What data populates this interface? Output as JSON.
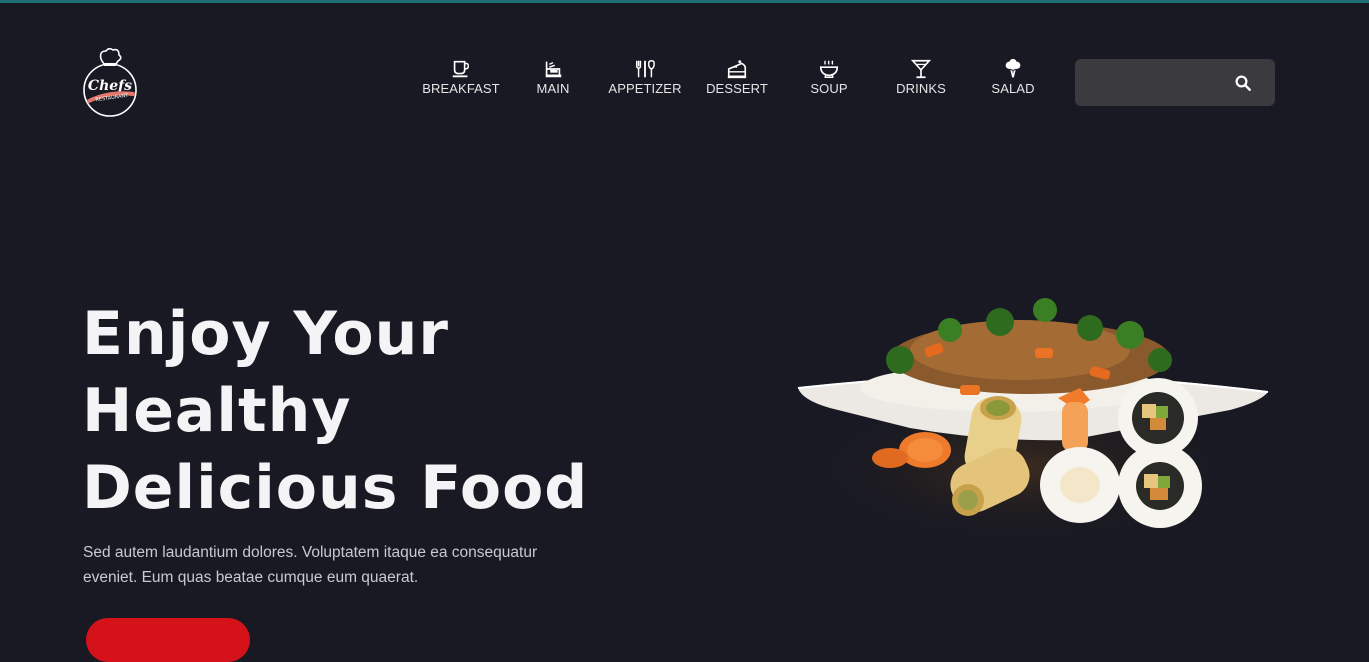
{
  "brand": {
    "logo_icon": "chef-hat-logo",
    "logo_text": "Chefs",
    "logo_subtext": "RESTAURANT"
  },
  "nav": {
    "items": [
      {
        "label": "BREAKFAST",
        "icon": "coffee-cup-icon"
      },
      {
        "label": "MAIN",
        "icon": "main-dish-icon"
      },
      {
        "label": "APPETIZER",
        "icon": "utensils-icon"
      },
      {
        "label": "DESSERT",
        "icon": "cake-icon"
      },
      {
        "label": "SOUP",
        "icon": "soup-bowl-icon"
      },
      {
        "label": "DRINKS",
        "icon": "cocktail-icon"
      },
      {
        "label": "SALAD",
        "icon": "broccoli-icon"
      }
    ]
  },
  "search": {
    "value": "",
    "placeholder": "",
    "icon": "search-icon"
  },
  "hero": {
    "title_line1": "Enjoy Your",
    "title_line2": "Healthy",
    "title_line3": "Delicious Food",
    "description": "Sed autem laudantium dolores. Voluptatem itaque ea consequatur eveniet. Eum quas beatae cumque eum quaerat.",
    "image": "food-platter-image"
  },
  "colors": {
    "background": "#181922",
    "accent_red": "#d5121a",
    "top_line": "#1e6f74",
    "search_bg": "#3a3a3f"
  }
}
